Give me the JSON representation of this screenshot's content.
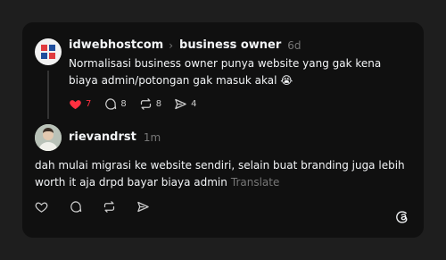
{
  "post": {
    "username": "idwebhostcom",
    "community": "business owner",
    "time": "6d",
    "text": "Normalisasi business owner punya website yang gak kena biaya admin/potongan gak masuk akal 😭",
    "likes": "7",
    "comments": "8",
    "reposts": "8",
    "shares": "4"
  },
  "reply": {
    "username": "rievandrst",
    "time": "1m",
    "text": "dah mulai migrasi ke website sendiri, selain buat branding juga lebih worth it aja drpd bayar biaya admin",
    "translate_label": "Translate"
  },
  "colors": {
    "like": "#ff3040",
    "background": "#101010",
    "page": "#1e1e1e"
  },
  "icons": [
    "heart-icon",
    "comment-icon",
    "repost-icon",
    "share-icon",
    "threads-logo-icon",
    "chevron-right-icon"
  ]
}
